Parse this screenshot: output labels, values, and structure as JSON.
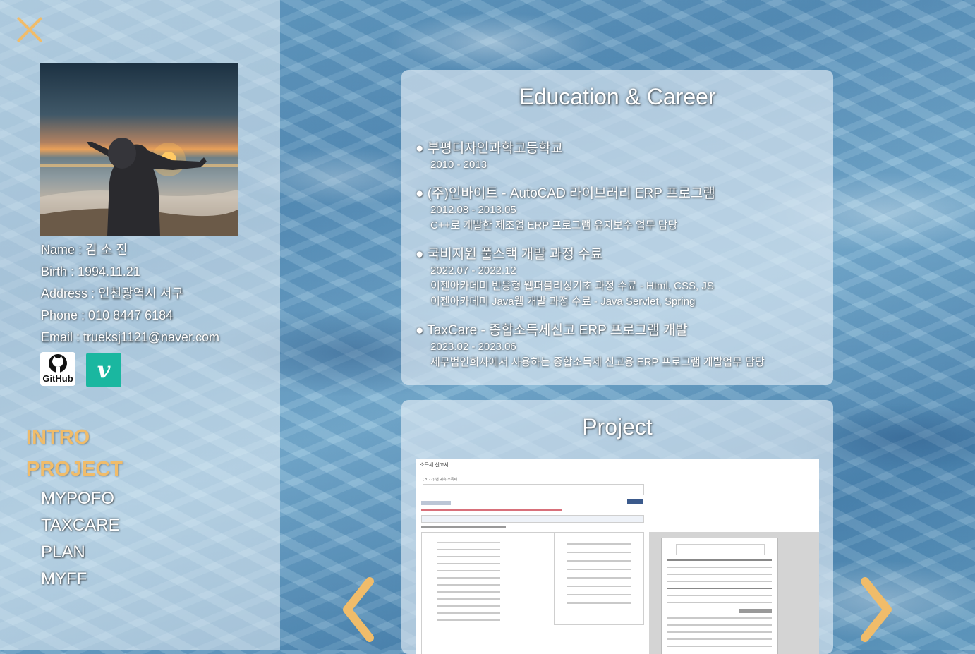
{
  "sidebar": {
    "close_icon": "close-icon",
    "profile": {
      "name": "Name : 김 소 진",
      "birth": "Birth : 1994.11.21",
      "address": "Address : 인천광역시 서구",
      "phone": "Phone : 010 8447 6184",
      "email": "Email : trueksj1121@naver.com"
    },
    "socials": {
      "github_label": "GitHub",
      "vimeo_label": "v"
    },
    "nav": {
      "intro": "INTRO",
      "project": "PROJECT",
      "sub": [
        "MYPOFO",
        "TAXCARE",
        "PLAN",
        "MYFF"
      ]
    }
  },
  "education": {
    "title": "Education & Career",
    "items": [
      {
        "heading": "● 부평디자인과학고등학교",
        "lines": [
          "2010 - 2013"
        ]
      },
      {
        "heading": "● (주)인바이트 - AutoCAD 라이브러리 ERP 프로그램",
        "lines": [
          "2012.08 - 2013.05",
          "C++로 개발한 제조업 ERP 프로그램 유지보수 업무 담당"
        ]
      },
      {
        "heading": "● 국비지원 풀스택 개발 과정 수료",
        "lines": [
          "2022.07 - 2022.12",
          "이젠아카데미 반응형 웹퍼블리싱기초 과정 수료 - Html, CSS, JS",
          "이젠아카데미 Java웹 개발 과정 수료 - Java Servlet, Spring"
        ]
      },
      {
        "heading": "● TaxCare - 종합소득세신고 ERP 프로그램 개발",
        "lines": [
          "2023.02 - 2023.06",
          "세무법인회사에서 사용하는 종합소득세 신고용 ERP 프로그램 개발업무 담당"
        ]
      }
    ]
  },
  "project": {
    "title": "Project",
    "screenshot": {
      "title": "소득세 신고서",
      "year": "(2022) 년 귀속 소득세"
    }
  },
  "colors": {
    "accent": "#f0bc6a",
    "vimeo": "#1ab7a0"
  }
}
